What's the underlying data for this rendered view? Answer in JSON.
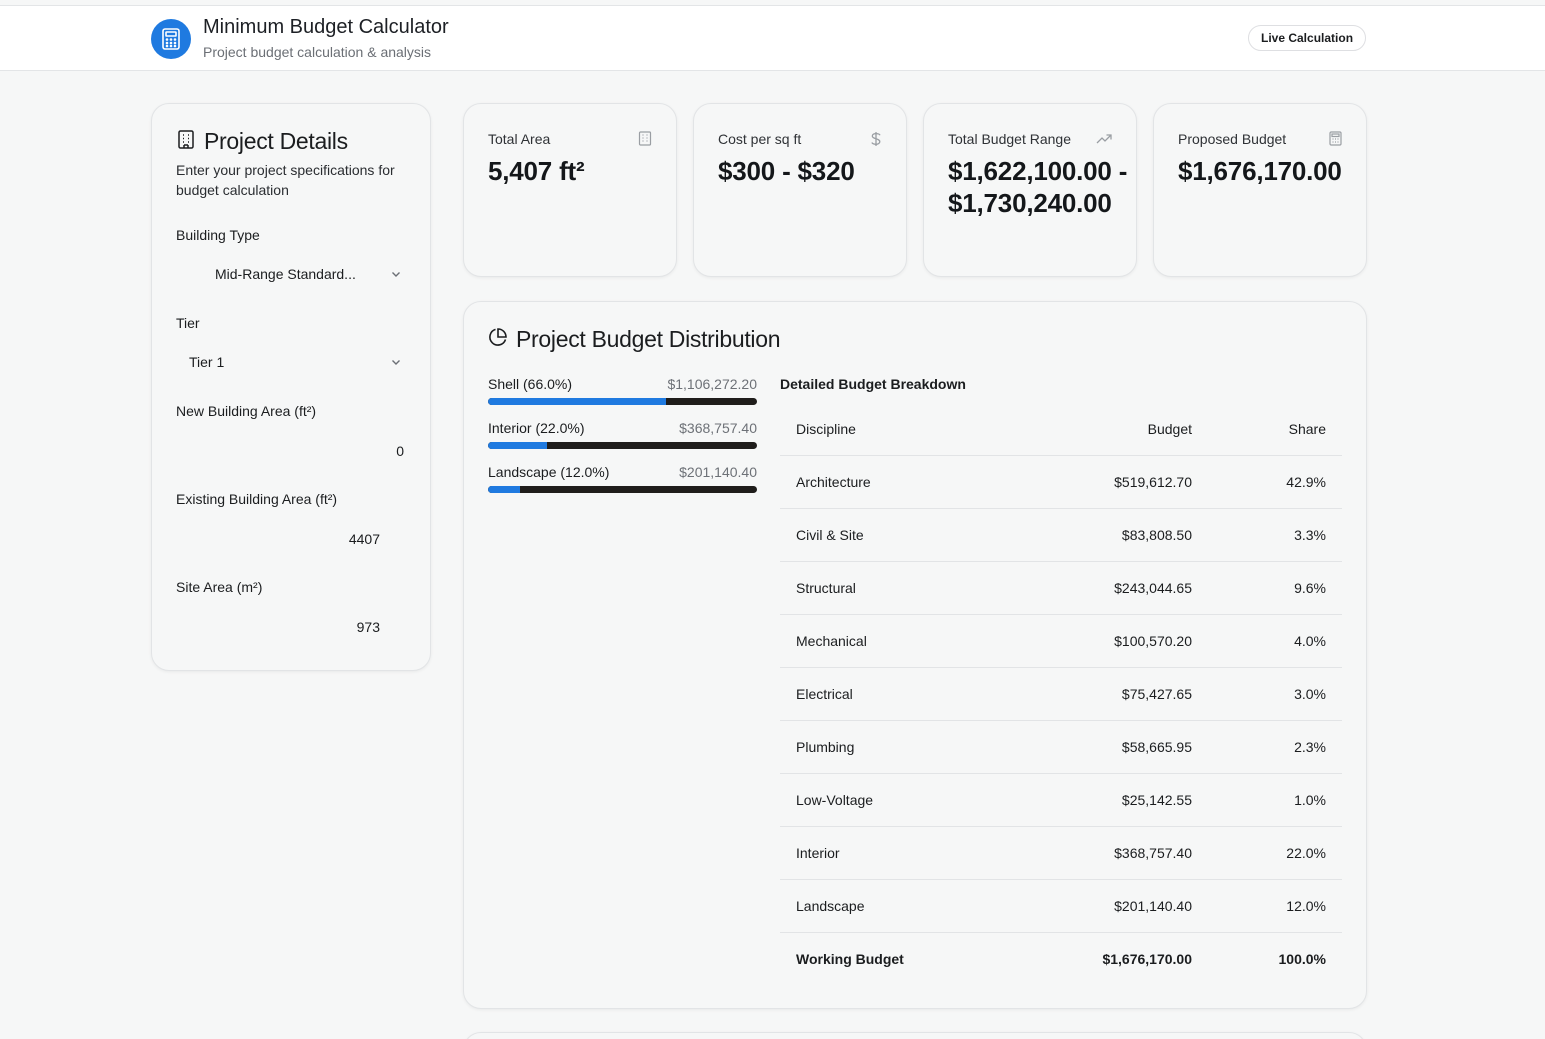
{
  "header": {
    "title": "Minimum Budget Calculator",
    "subtitle": "Project budget calculation & analysis",
    "badge": "Live Calculation"
  },
  "project_details": {
    "title": "Project Details",
    "description": "Enter your project specifications for budget calculation",
    "building_type": {
      "label": "Building Type",
      "value": "Mid-Range Standard..."
    },
    "tier": {
      "label": "Tier",
      "value": "Tier 1"
    },
    "new_area": {
      "label": "New Building Area (ft²)",
      "value": "0"
    },
    "existing_area": {
      "label": "Existing Building Area (ft²)",
      "value": "4407"
    },
    "site_area": {
      "label": "Site Area (m²)",
      "value": "973"
    }
  },
  "stats": {
    "total_area": {
      "label": "Total Area",
      "value": "5,407 ft²",
      "icon": "building-icon"
    },
    "cost_per_sqft": {
      "label": "Cost per sq ft",
      "value": "$300 - $320",
      "icon": "dollar-icon"
    },
    "budget_range": {
      "label": "Total Budget Range",
      "value": "$1,622,100.00 - $1,730,240.00",
      "icon": "trending-up-icon"
    },
    "proposed": {
      "label": "Proposed Budget",
      "value": "$1,676,170.00",
      "icon": "calculator-icon"
    }
  },
  "distribution": {
    "title": "Project Budget Distribution",
    "bars": [
      {
        "name": "Shell (66.0%)",
        "amount": "$1,106,272.20",
        "fraction": 0.66
      },
      {
        "name": "Interior (22.0%)",
        "amount": "$368,757.40",
        "fraction": 0.22
      },
      {
        "name": "Landscape (12.0%)",
        "amount": "$201,140.40",
        "fraction": 0.12
      }
    ],
    "breakdown_title": "Detailed Budget Breakdown",
    "columns": [
      "Discipline",
      "Budget",
      "Share"
    ],
    "rows": [
      [
        "Architecture",
        "$519,612.70",
        "42.9%"
      ],
      [
        "Civil & Site",
        "$83,808.50",
        "3.3%"
      ],
      [
        "Structural",
        "$243,044.65",
        "9.6%"
      ],
      [
        "Mechanical",
        "$100,570.20",
        "4.0%"
      ],
      [
        "Electrical",
        "$75,427.65",
        "3.0%"
      ],
      [
        "Plumbing",
        "$58,665.95",
        "2.3%"
      ],
      [
        "Low-Voltage",
        "$25,142.55",
        "1.0%"
      ],
      [
        "Interior",
        "$368,757.40",
        "22.0%"
      ],
      [
        "Landscape",
        "$201,140.40",
        "12.0%"
      ],
      [
        "Working Budget",
        "$1,676,170.00",
        "100.0%"
      ]
    ]
  },
  "colors": {
    "accent": "#1f7ae0",
    "bar_track": "#1f1d1b",
    "background": "#f6f7f7"
  }
}
